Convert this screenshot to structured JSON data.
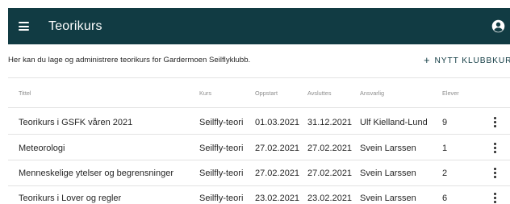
{
  "appbar": {
    "title": "Teorikurs",
    "menu_icon": "hamburger-menu-icon",
    "account_icon": "account-circle-icon",
    "background_color": "#113b43"
  },
  "intro": {
    "text": "Her kan du lage og administrere teorikurs for Gardermoen Seilflyklubb."
  },
  "actions": {
    "new_club_course_label": "NYTT KLUBBKURS",
    "plus_symbol": "+"
  },
  "table": {
    "columns": [
      "Tittel",
      "Kurs",
      "Oppstart",
      "Avsluttes",
      "Ansvarlig",
      "Elever"
    ],
    "rows": [
      {
        "title": "Teorikurs i GSFK våren 2021",
        "course": "Seilfly-teori",
        "start": "01.03.2021",
        "end": "31.12.2021",
        "responsible": "Ulf Kielland-Lund",
        "students": "9"
      },
      {
        "title": "Meteorologi",
        "course": "Seilfly-teori",
        "start": "27.02.2021",
        "end": "27.02.2021",
        "responsible": "Svein Larssen",
        "students": "1"
      },
      {
        "title": "Menneskelige ytelser og begrensninger",
        "course": "Seilfly-teori",
        "start": "27.02.2021",
        "end": "27.02.2021",
        "responsible": "Svein Larssen",
        "students": "2"
      },
      {
        "title": "Teorikurs i Lover og regler",
        "course": "Seilfly-teori",
        "start": "23.02.2021",
        "end": "23.02.2021",
        "responsible": "Svein Larssen",
        "students": "6"
      }
    ],
    "row_menu_icon": "more-vert-icon"
  }
}
